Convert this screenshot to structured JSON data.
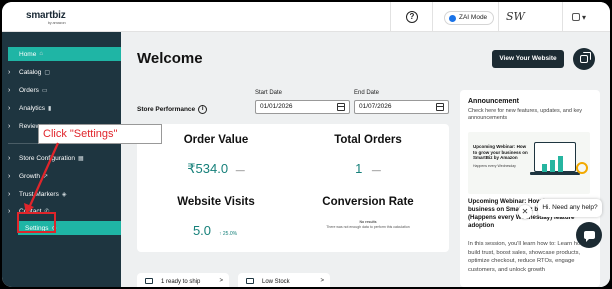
{
  "topbar": {
    "logo_text": "smartbiz",
    "logo_sub": "by amazon",
    "help_icon": "?",
    "zai_mode_label": "ZAI Mode",
    "store_logo_text": "SW"
  },
  "sidebar": {
    "items": [
      {
        "label": "Home",
        "icon": "house-icon"
      },
      {
        "label": "Catalog",
        "icon": "box-icon"
      },
      {
        "label": "Orders",
        "icon": "cart-icon"
      },
      {
        "label": "Analytics",
        "icon": "chart-icon"
      },
      {
        "label": "Reviews",
        "icon": "star-icon"
      },
      {
        "label": "Store Configuration",
        "icon": "store-icon"
      },
      {
        "label": "Growth",
        "icon": "growth-icon"
      },
      {
        "label": "Trust Markers",
        "icon": "shield-icon"
      },
      {
        "label": "Contact",
        "icon": "phone-icon"
      },
      {
        "label": "Settings",
        "icon": "gear-icon"
      }
    ]
  },
  "main": {
    "welcome": "Welcome",
    "view_site_label": "View Your Website",
    "store_performance_label": "Store Performance",
    "start_date_label": "Start Date",
    "start_date_value": "01/01/2026",
    "end_date_label": "End Date",
    "end_date_value": "01/07/2026",
    "metrics": {
      "order_value_title": "Order Value",
      "order_value": "₹534.0",
      "order_value_dash": "—",
      "total_orders_title": "Total Orders",
      "total_orders": "1",
      "total_orders_dash": "—",
      "website_visits_title": "Website Visits",
      "website_visits": "5.0",
      "website_visits_delta": "↑ 25.0%",
      "conversion_rate_title": "Conversion Rate",
      "conversion_no_results_title": "No results",
      "conversion_no_results_body": "There was not enough data to perform this calculation"
    },
    "bottom_cards": [
      {
        "label": "1 ready to ship",
        "chevron": ">"
      },
      {
        "label": "Low Stock",
        "chevron": ">"
      }
    ]
  },
  "announcement": {
    "title": "Announcement",
    "desc": "Check here for new features, updates, and key announcements",
    "image_title": "Upcoming Webinar: How to grow your business on SmartBiz by Amazon",
    "image_sub": "Happens every Wednesday",
    "headline": "Upcoming Webinar: How to grow your business on SmartBiz by Amazon (Happens every Wednesday) feature adoption",
    "body": "In this session, you'll learn how to: Learn how to build trust, boost sales, showcase products, optimize checkout, reduce RTOs, engage customers, and unlock growth"
  },
  "chat": {
    "close": "✕",
    "bubble": "Hi. Need any help?"
  },
  "annotation": {
    "callout": "Click \"Settings\""
  },
  "colors": {
    "sidebar_bg": "#1e3540",
    "accent_teal": "#1fb5a5",
    "metric_teal": "#16807a",
    "annotation_red": "#e0252b"
  }
}
